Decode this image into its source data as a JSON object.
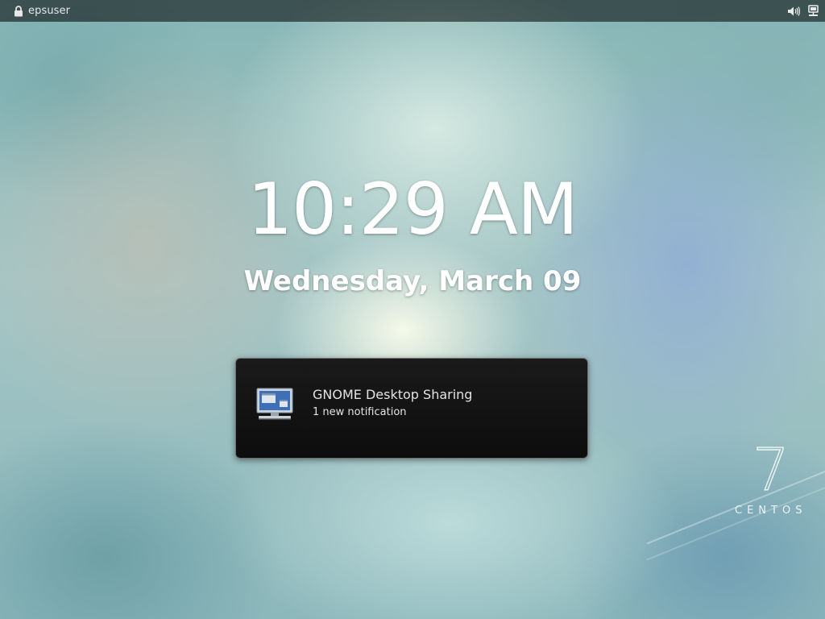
{
  "top_bar": {
    "user_name": "epsuser",
    "icons": [
      "lock-icon",
      "volume-icon",
      "network-icon"
    ]
  },
  "lock_screen": {
    "time": "10:29 AM",
    "date": "Wednesday, March 09"
  },
  "notification": {
    "app_icon": "desktop-sharing-icon",
    "title": "GNOME Desktop Sharing",
    "summary": "1 new notification"
  },
  "branding": {
    "logo_number": "7",
    "logo_text": "CENTOS"
  },
  "colors": {
    "top_bar": "#000000",
    "notification_bg": "#111111",
    "text": "#ffffff"
  }
}
